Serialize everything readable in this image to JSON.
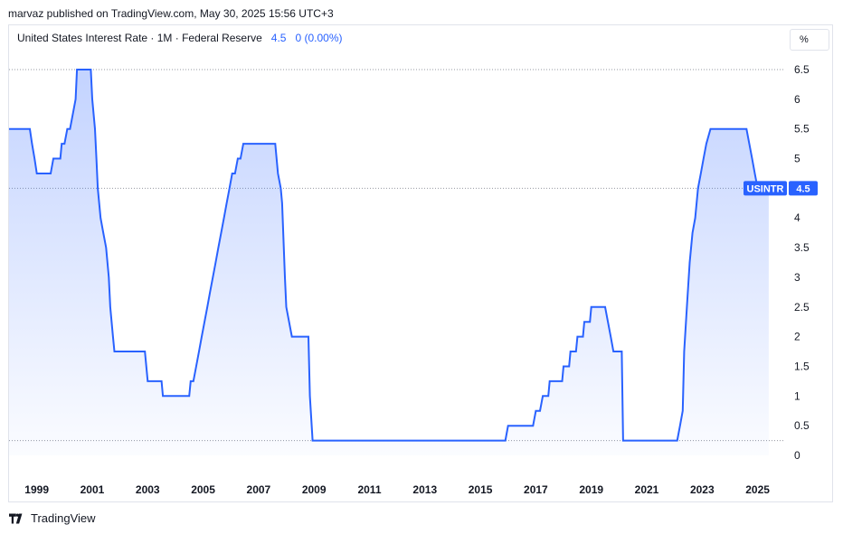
{
  "header": {
    "published": "marvaz published on TradingView.com, May 30, 2025 15:56 UTC+3"
  },
  "legend": {
    "title": "United States Interest Rate · 1M · Federal Reserve",
    "value": "4.5",
    "change": "0 (0.00%)"
  },
  "unit_label": "%",
  "price_label": {
    "symbol": "USINTR",
    "value": "4.5"
  },
  "footer": {
    "brand": "TradingView"
  },
  "colors": {
    "line": "#2962ff",
    "grid_dots": "#9598a1",
    "label_bg": "#2962ff"
  },
  "chart_data": {
    "type": "area",
    "title": "United States Interest Rate · 1M · Federal Reserve",
    "xlabel": "",
    "ylabel": "%",
    "ylim": [
      0,
      6.5
    ],
    "xlim": [
      1998.0,
      2025.6
    ],
    "yticks": [
      "6.5",
      "6",
      "5.5",
      "5",
      "4.5",
      "4",
      "3.5",
      "3",
      "2.5",
      "2",
      "1.5",
      "1",
      "0.5",
      "0"
    ],
    "xticks": [
      "1999",
      "2001",
      "2003",
      "2005",
      "2007",
      "2009",
      "2011",
      "2013",
      "2015",
      "2017",
      "2019",
      "2021",
      "2023",
      "2025"
    ],
    "series": [
      {
        "x": [
          1998.0,
          1998.75,
          1998.83,
          1998.92,
          1999.0,
          1999.5,
          1999.6,
          1999.85,
          1999.9,
          2000.0,
          2000.1,
          2000.2,
          2000.3,
          2000.4,
          2000.45,
          2000.95,
          2001.0,
          2001.1,
          2001.15,
          2001.2,
          2001.3,
          2001.4,
          2001.5,
          2001.6,
          2001.65,
          2001.75,
          2001.8,
          2001.9,
          2001.95,
          2002.9,
          2003.0,
          2003.5,
          2003.55,
          2004.5,
          2004.55,
          2004.65,
          2004.75,
          2004.85,
          2004.95,
          2005.05,
          2005.15,
          2005.25,
          2005.35,
          2005.45,
          2005.55,
          2005.65,
          2005.75,
          2005.85,
          2005.95,
          2006.05,
          2006.15,
          2006.25,
          2006.35,
          2006.45,
          2006.55,
          2007.6,
          2007.7,
          2007.8,
          2007.85,
          2007.95,
          2008.0,
          2008.1,
          2008.2,
          2008.25,
          2008.3,
          2008.8,
          2008.85,
          2008.95,
          2009.0,
          2015.9,
          2016.0,
          2016.9,
          2017.0,
          2017.15,
          2017.25,
          2017.45,
          2017.5,
          2017.95,
          2018.0,
          2018.2,
          2018.25,
          2018.45,
          2018.5,
          2018.7,
          2018.75,
          2018.95,
          2019.0,
          2019.5,
          2019.6,
          2019.7,
          2019.8,
          2020.1,
          2020.15,
          2020.2,
          2022.1,
          2022.2,
          2022.3,
          2022.35,
          2022.45,
          2022.55,
          2022.65,
          2022.75,
          2022.85,
          2022.95,
          2023.05,
          2023.15,
          2023.3,
          2023.45,
          2023.5,
          2024.6,
          2024.7,
          2024.8,
          2024.9,
          2025.0,
          2025.4
        ],
        "y": [
          5.5,
          5.5,
          5.25,
          5.0,
          4.75,
          4.75,
          5.0,
          5.0,
          5.25,
          5.25,
          5.5,
          5.5,
          5.75,
          6.0,
          6.5,
          6.5,
          6.0,
          5.5,
          5.0,
          4.5,
          4.0,
          3.75,
          3.5,
          3.0,
          2.5,
          2.0,
          1.75,
          1.75,
          1.75,
          1.75,
          1.25,
          1.25,
          1.0,
          1.0,
          1.25,
          1.25,
          1.5,
          1.75,
          2.0,
          2.25,
          2.5,
          2.75,
          3.0,
          3.25,
          3.5,
          3.75,
          4.0,
          4.25,
          4.5,
          4.75,
          4.75,
          5.0,
          5.0,
          5.25,
          5.25,
          5.25,
          4.75,
          4.5,
          4.25,
          3.0,
          2.5,
          2.25,
          2.0,
          2.0,
          2.0,
          2.0,
          1.0,
          0.25,
          0.25,
          0.25,
          0.5,
          0.5,
          0.75,
          0.75,
          1.0,
          1.0,
          1.25,
          1.25,
          1.5,
          1.5,
          1.75,
          1.75,
          2.0,
          2.0,
          2.25,
          2.25,
          2.5,
          2.5,
          2.25,
          2.0,
          1.75,
          1.75,
          0.25,
          0.25,
          0.25,
          0.5,
          0.75,
          1.75,
          2.5,
          3.25,
          3.75,
          4.0,
          4.5,
          4.75,
          5.0,
          5.25,
          5.5,
          5.5,
          5.5,
          5.5,
          5.25,
          5.0,
          4.75,
          4.5,
          4.5
        ]
      }
    ],
    "reference_lines": [
      6.5,
      4.5,
      0.25
    ]
  }
}
